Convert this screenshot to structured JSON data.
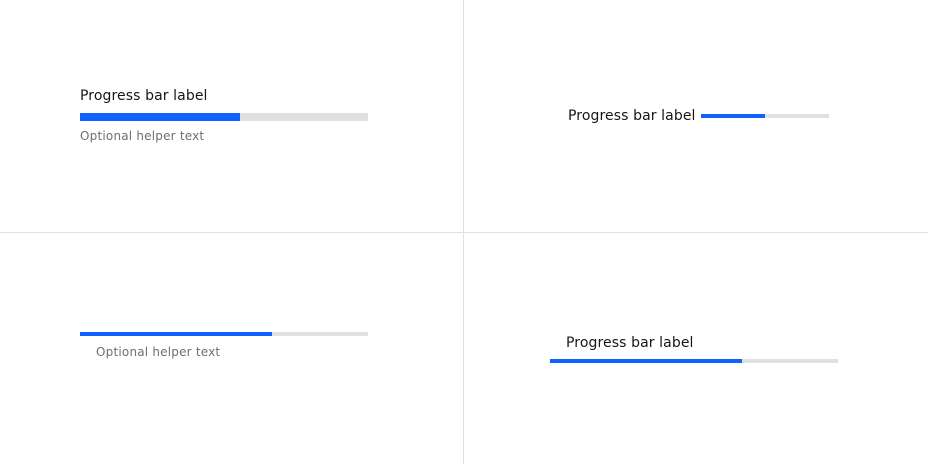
{
  "colors": {
    "fill": "#0f62fe",
    "track": "#e0e0e0",
    "label": "#161616",
    "helper": "#6f6f6f",
    "divider": "#e0e0e0"
  },
  "variants": [
    {
      "label": "Progress bar label",
      "helper": "Optional helper text",
      "progress": 0.555
    },
    {
      "label": "Progress bar label",
      "helper": "",
      "progress": 0.5
    },
    {
      "label": "",
      "helper": "Optional helper text",
      "progress": 0.667
    },
    {
      "label": "Progress bar label",
      "helper": "",
      "progress": 0.667
    }
  ]
}
